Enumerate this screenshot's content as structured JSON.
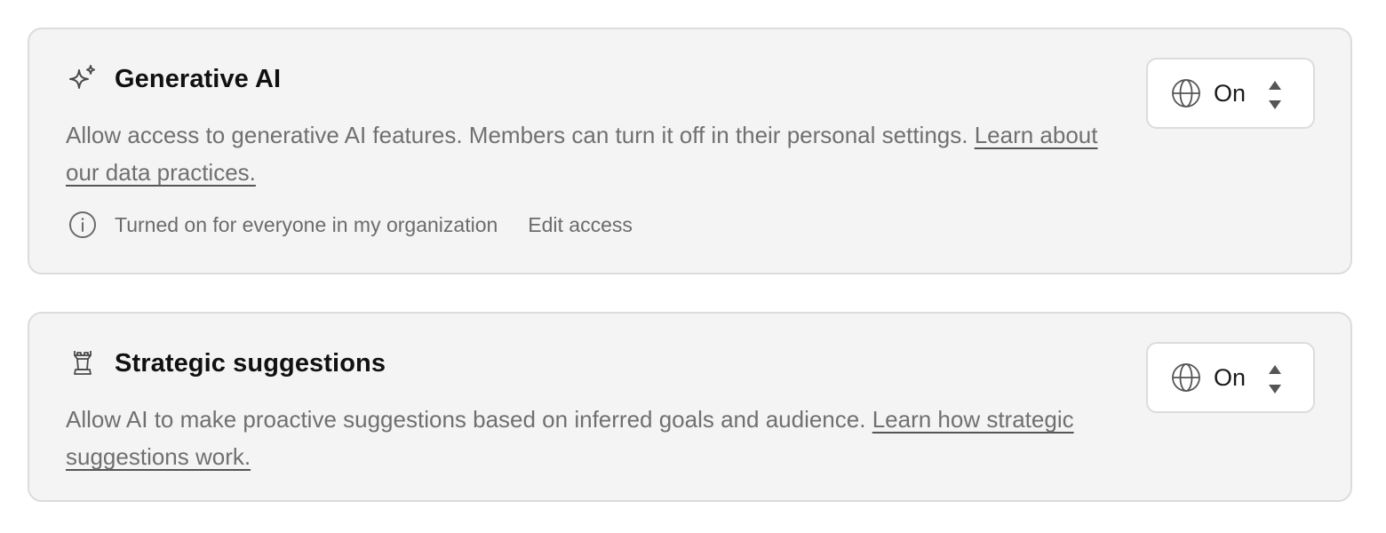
{
  "generative_ai": {
    "title": "Generative AI",
    "icon": "sparkle-icon",
    "description": "Allow access to generative AI features. Members can turn it off in their personal settings. ",
    "link_text": "Learn about our data practices.",
    "status_text": "Turned on for everyone in my organization",
    "edit_access_label": "Edit access",
    "select_value": "On",
    "select_icon": "globe-icon"
  },
  "strategic_suggestions": {
    "title": "Strategic suggestions",
    "icon": "chess-rook-icon",
    "description": "Allow AI to make proactive suggestions based on inferred goals and audience. ",
    "link_text": "Learn how strategic suggestions work.",
    "select_value": "On",
    "select_icon": "globe-icon"
  },
  "colors": {
    "card_background": "#f4f4f4",
    "card_border": "#dcdcdc",
    "title_text": "#111111",
    "body_text": "#707070"
  }
}
